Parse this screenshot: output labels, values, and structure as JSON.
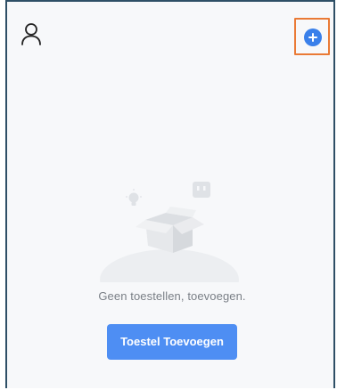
{
  "header": {
    "user_icon": "user-icon",
    "add_icon": "plus-circle-icon"
  },
  "empty_state": {
    "illustration": "empty-box-illustration",
    "message": "Geen toestellen, toevoegen.",
    "button_label": "Toestel Toevoegen"
  },
  "colors": {
    "accent": "#3a80ea",
    "button": "#4e8ef3",
    "highlight": "#ea7a35",
    "frame": "#2e4f66",
    "muted_text": "#7a7f86"
  }
}
